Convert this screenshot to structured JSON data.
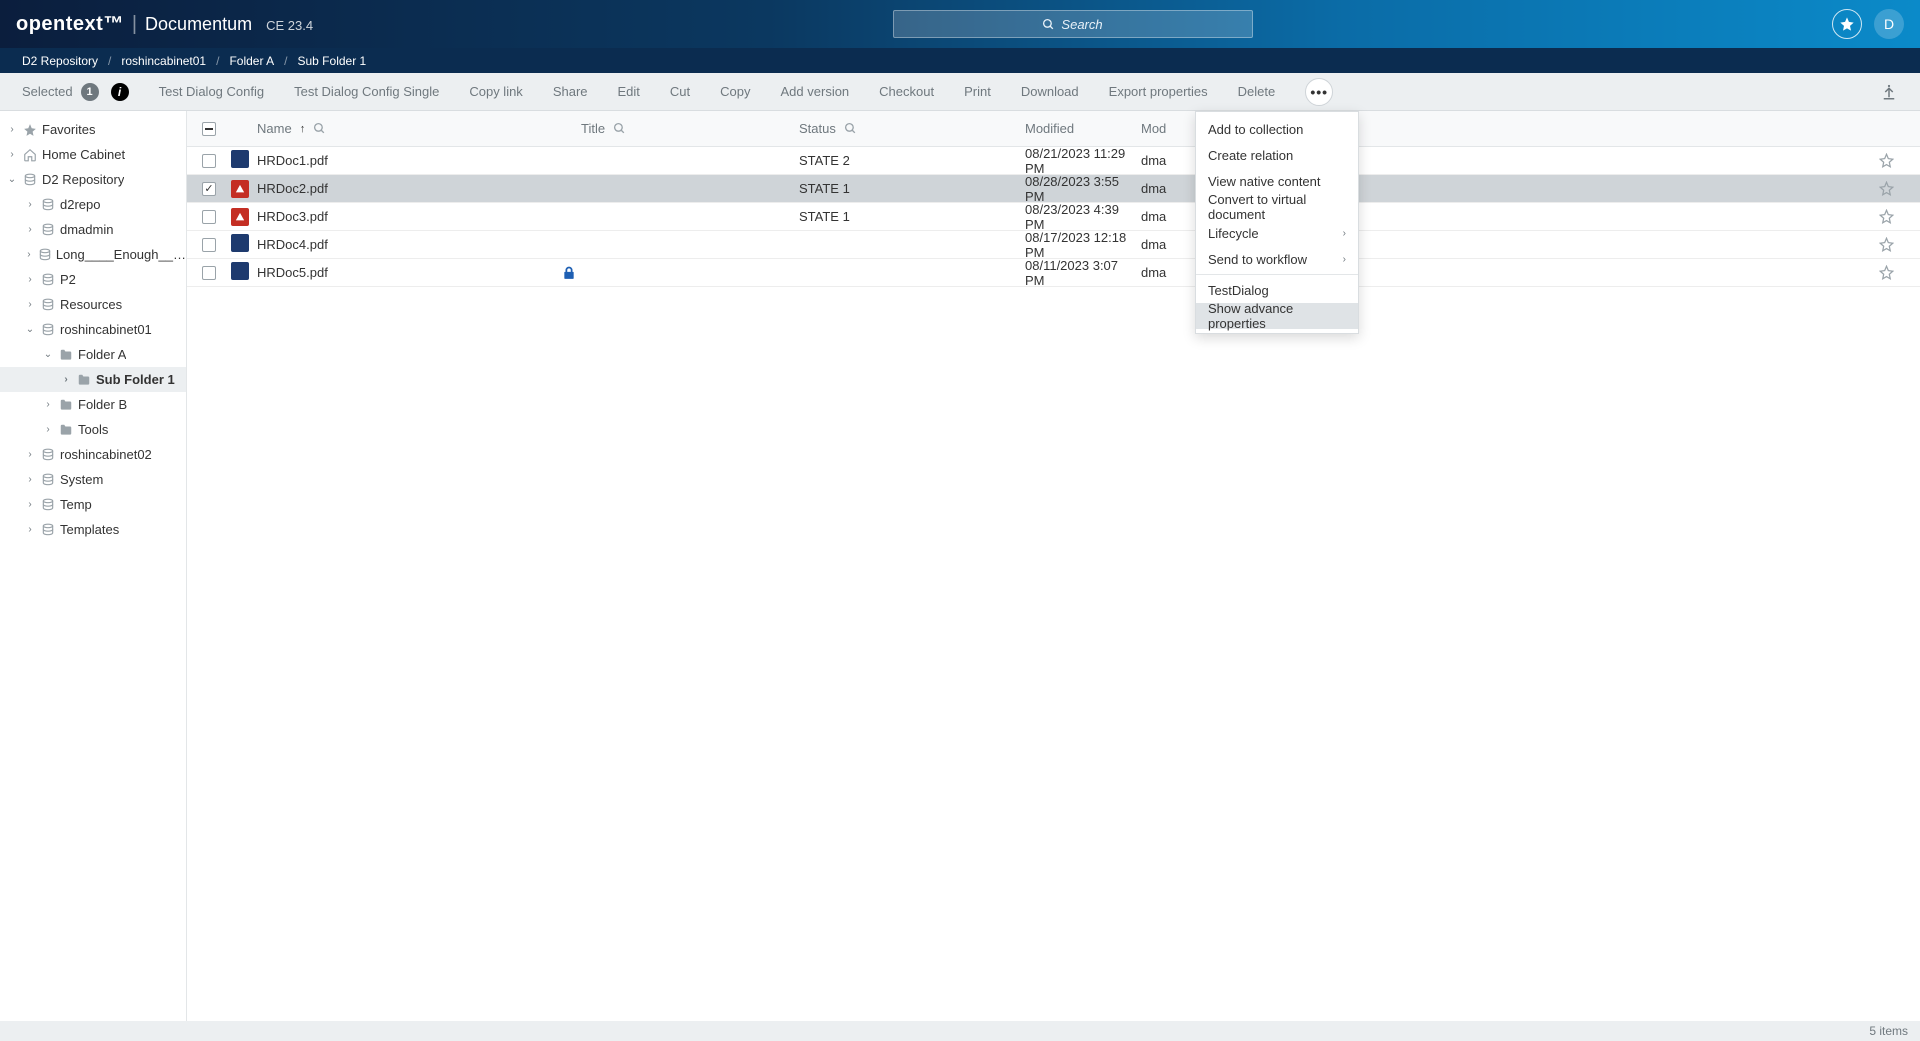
{
  "header": {
    "brand_ot": "opentext™",
    "brand_prod": "Documentum",
    "brand_ver": "CE 23.4",
    "search_placeholder": "Search",
    "avatar_letter": "D"
  },
  "breadcrumb": [
    "D2 Repository",
    "roshincabinet01",
    "Folder A",
    "Sub Folder 1"
  ],
  "toolbar": {
    "selected_label": "Selected",
    "selected_count": "1",
    "actions": [
      "Test Dialog Config",
      "Test Dialog Config Single",
      "Copy link",
      "Share",
      "Edit",
      "Cut",
      "Copy",
      "Add version",
      "Checkout",
      "Print",
      "Download",
      "Export properties",
      "Delete"
    ]
  },
  "dropdown": {
    "items": [
      {
        "label": "Add to collection",
        "caret": false
      },
      {
        "label": "Create relation",
        "caret": false
      },
      {
        "label": "View native content",
        "caret": false
      },
      {
        "label": "Convert to virtual document",
        "caret": false
      },
      {
        "label": "Lifecycle",
        "caret": true
      },
      {
        "label": "Send to workflow",
        "caret": true
      },
      {
        "sep": true
      },
      {
        "label": "TestDialog",
        "caret": false
      },
      {
        "label": "Show advance properties",
        "caret": false,
        "highlight": true
      }
    ]
  },
  "sidebar": [
    {
      "label": "Favorites",
      "icon": "star",
      "depth": 0,
      "tw": "›"
    },
    {
      "label": "Home Cabinet",
      "icon": "home",
      "depth": 0,
      "tw": "›"
    },
    {
      "label": "D2 Repository",
      "icon": "db",
      "depth": 0,
      "tw": "v"
    },
    {
      "label": "d2repo",
      "icon": "db",
      "depth": 1,
      "tw": "›"
    },
    {
      "label": "dmadmin",
      "icon": "db",
      "depth": 1,
      "tw": "›"
    },
    {
      "label": "Long____Enough____Ca...",
      "icon": "db",
      "depth": 1,
      "tw": "›"
    },
    {
      "label": "P2",
      "icon": "db",
      "depth": 1,
      "tw": "›"
    },
    {
      "label": "Resources",
      "icon": "db",
      "depth": 1,
      "tw": "›"
    },
    {
      "label": "roshincabinet01",
      "icon": "db",
      "depth": 1,
      "tw": "v"
    },
    {
      "label": "Folder A",
      "icon": "folder",
      "depth": 2,
      "tw": "v"
    },
    {
      "label": "Sub Folder 1",
      "icon": "folder",
      "depth": 3,
      "tw": "›",
      "selected": true
    },
    {
      "label": "Folder B",
      "icon": "folder",
      "depth": 2,
      "tw": "›"
    },
    {
      "label": "Tools",
      "icon": "folder",
      "depth": 2,
      "tw": "›"
    },
    {
      "label": "roshincabinet02",
      "icon": "db",
      "depth": 1,
      "tw": "›"
    },
    {
      "label": "System",
      "icon": "db",
      "depth": 1,
      "tw": "›"
    },
    {
      "label": "Temp",
      "icon": "db",
      "depth": 1,
      "tw": "›"
    },
    {
      "label": "Templates",
      "icon": "db",
      "depth": 1,
      "tw": "›"
    }
  ],
  "columns": {
    "name": "Name",
    "title": "Title",
    "status": "Status",
    "modified": "Modified",
    "modby": "Mod"
  },
  "rows": [
    {
      "name": "HRDoc1.pdf",
      "status": "STATE 2",
      "modified": "08/21/2023 11:29 PM",
      "modby": "dma",
      "icon": "blue",
      "checked": false,
      "lock": false
    },
    {
      "name": "HRDoc2.pdf",
      "status": "STATE 1",
      "modified": "08/28/2023 3:55 PM",
      "modby": "dma",
      "icon": "red",
      "checked": true,
      "lock": false,
      "selected": true
    },
    {
      "name": "HRDoc3.pdf",
      "status": "STATE 1",
      "modified": "08/23/2023 4:39 PM",
      "modby": "dma",
      "icon": "red",
      "checked": false,
      "lock": false
    },
    {
      "name": "HRDoc4.pdf",
      "status": "",
      "modified": "08/17/2023 12:18 PM",
      "modby": "dma",
      "icon": "blue",
      "checked": false,
      "lock": false
    },
    {
      "name": "HRDoc5.pdf",
      "status": "",
      "modified": "08/11/2023 3:07 PM",
      "modby": "dma",
      "icon": "blue",
      "checked": false,
      "lock": true
    }
  ],
  "footer": {
    "count": "5 items"
  }
}
